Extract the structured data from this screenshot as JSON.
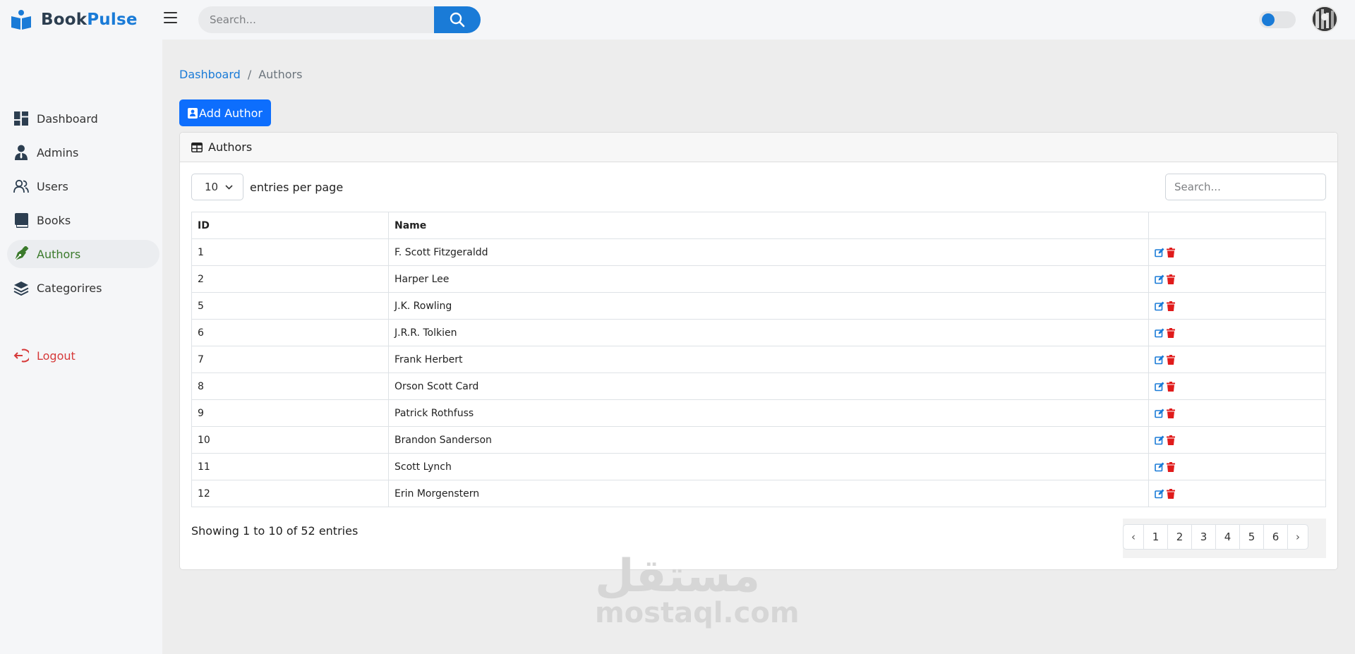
{
  "brand": {
    "name_part1": "Book",
    "name_part2": "Pulse"
  },
  "topbar": {
    "search_placeholder": "Search..."
  },
  "sidebar": {
    "items": [
      {
        "label": "Dashboard",
        "icon": "dashboard-grid-icon"
      },
      {
        "label": "Admins",
        "icon": "admin-user-icon"
      },
      {
        "label": "Users",
        "icon": "users-icon"
      },
      {
        "label": "Books",
        "icon": "book-icon"
      },
      {
        "label": "Authors",
        "icon": "pen-nib-icon",
        "active": true
      },
      {
        "label": "Categorires",
        "icon": "layers-icon"
      }
    ],
    "logout": {
      "label": "Logout",
      "icon": "logout-icon"
    }
  },
  "breadcrumb": {
    "home": "Dashboard",
    "separator": "/",
    "current": "Authors"
  },
  "add_button": {
    "label": "Add Author"
  },
  "card": {
    "title": "Authors"
  },
  "table_controls": {
    "per_page_value": "10",
    "per_page_label": "entries per page",
    "search_placeholder": "Search..."
  },
  "table": {
    "headers": {
      "id": "ID",
      "name": "Name",
      "actions": ""
    },
    "rows": [
      {
        "id": "1",
        "name": "F. Scott Fitzgeraldd"
      },
      {
        "id": "2",
        "name": "Harper Lee"
      },
      {
        "id": "5",
        "name": "J.K. Rowling"
      },
      {
        "id": "6",
        "name": "J.R.R. Tolkien"
      },
      {
        "id": "7",
        "name": "Frank Herbert"
      },
      {
        "id": "8",
        "name": "Orson Scott Card"
      },
      {
        "id": "9",
        "name": "Patrick Rothfuss"
      },
      {
        "id": "10",
        "name": "Brandon Sanderson"
      },
      {
        "id": "11",
        "name": "Scott Lynch"
      },
      {
        "id": "12",
        "name": "Erin Morgenstern"
      }
    ]
  },
  "footer": {
    "showing": "Showing 1 to 10 of 52 entries"
  },
  "pagination": {
    "prev": "‹",
    "pages": [
      "1",
      "2",
      "3",
      "4",
      "5",
      "6"
    ],
    "next": "›"
  },
  "watermark": {
    "arabic": "مستقل",
    "latin": "mostaql.com"
  },
  "colors": {
    "brand_blue": "#1a7bd7",
    "primary_button": "#0d6efd",
    "active_nav": "#3b7a2c",
    "logout_red": "#d63a3a",
    "delete_red": "#e01b1b"
  }
}
